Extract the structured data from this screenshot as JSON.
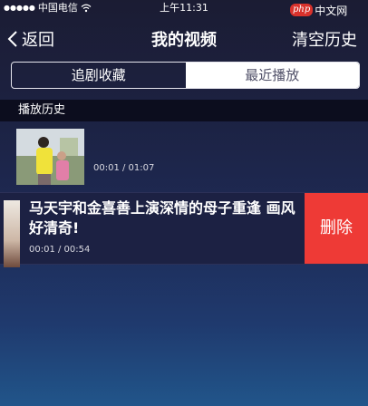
{
  "status_bar": {
    "carrier": "中国电信",
    "time": "上午11:31"
  },
  "watermark": {
    "badge": "php",
    "text": "中文网"
  },
  "nav": {
    "back_label": "返回",
    "title": "我的视频",
    "action_label": "清空历史"
  },
  "tabs": [
    {
      "label": "追剧收藏",
      "active": false
    },
    {
      "label": "最近播放",
      "active": true
    }
  ],
  "section": {
    "title": "播放历史"
  },
  "history": [
    {
      "title": "",
      "progress": "00:01 / 01:07"
    },
    {
      "title": "马天宇和金喜善上演深情的母子重逢 画风好清奇!",
      "progress": "00:01 / 00:54"
    }
  ],
  "delete_label": "删除",
  "colors": {
    "delete": "#ee3a36",
    "background_top": "#1b1c33",
    "background_bottom": "#21558a"
  }
}
